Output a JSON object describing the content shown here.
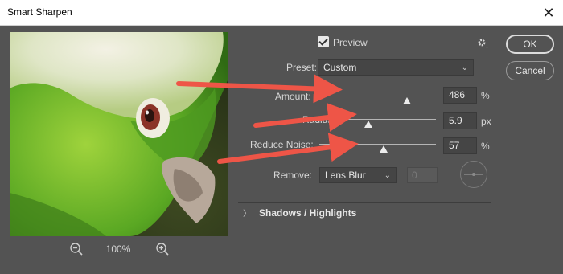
{
  "window": {
    "title": "Smart Sharpen",
    "close_glyph": "✕"
  },
  "preview_panel": {
    "zoom_value": "100%",
    "image_subject": "parrot-closeup"
  },
  "controls": {
    "preview_label": "Preview",
    "preview_checked": true,
    "preset_label": "Preset:",
    "preset_value": "Custom",
    "amount": {
      "label": "Amount:",
      "value": "486",
      "unit": "%",
      "slider_fraction": 0.75
    },
    "radius": {
      "label": "Radius:",
      "value": "5.9",
      "unit": "px",
      "slider_fraction": 0.42
    },
    "reduce_noise": {
      "label": "Reduce Noise:",
      "value": "57",
      "unit": "%",
      "slider_fraction": 0.55
    },
    "remove_label": "Remove:",
    "remove_value": "Lens Blur",
    "angle_value": "0",
    "shadows_highlights": "Shadows / Highlights"
  },
  "buttons": {
    "ok": "OK",
    "cancel": "Cancel"
  },
  "annotation_colors": {
    "arrow": "#ee5547"
  },
  "icons": [
    "zoom-out-icon",
    "zoom-in-icon",
    "gear-icon",
    "checkbox-icon",
    "chevron-down-icon",
    "chevron-right-icon",
    "angle-dial-icon"
  ]
}
